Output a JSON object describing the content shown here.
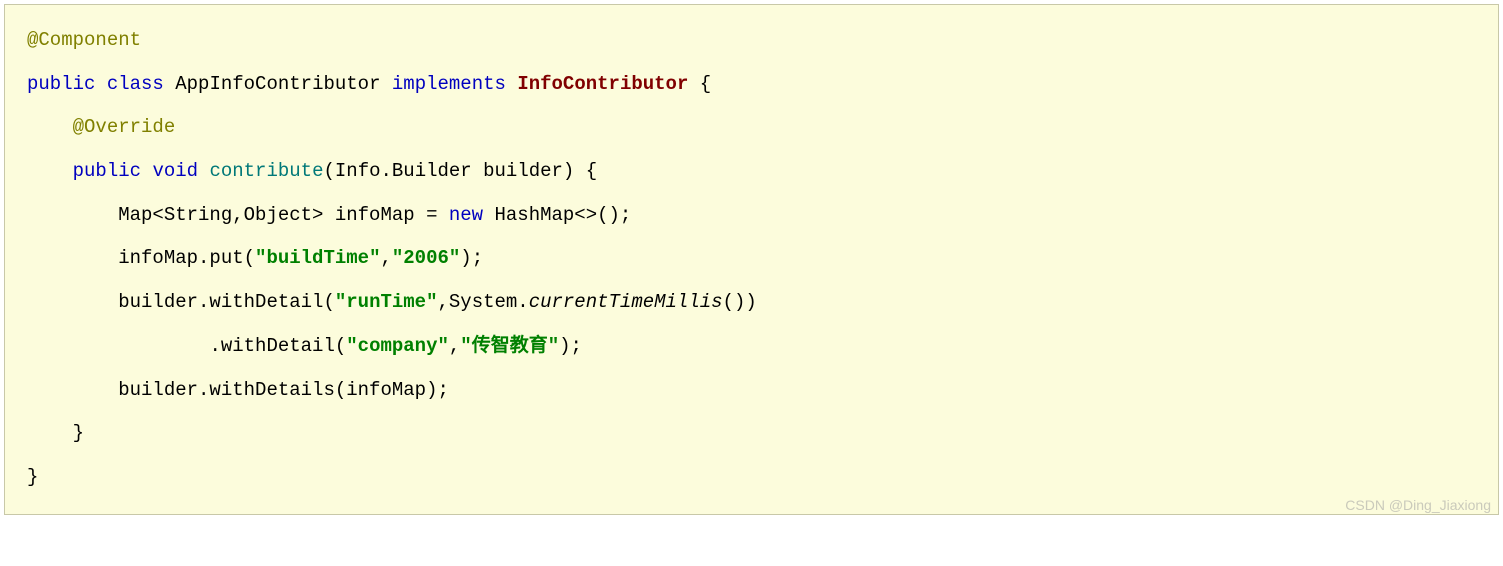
{
  "code": {
    "line1": {
      "annotation": "@Component"
    },
    "line2": {
      "kw_public": "public",
      "kw_class": "class",
      "class_name": " AppInfoContributor ",
      "kw_implements": "implements",
      "interface_name": "InfoContributor",
      "brace": " {"
    },
    "line3": {
      "indent": "    ",
      "annotation": "@Override"
    },
    "line4": {
      "indent": "    ",
      "kw_public": "public",
      "kw_void": "void",
      "method_name": "contribute",
      "params": "(Info.Builder builder) {"
    },
    "line5": {
      "indent": "        ",
      "text1": "Map<String,Object> infoMap = ",
      "kw_new": "new",
      "text2": " HashMap<>();"
    },
    "line6": {
      "indent": "        ",
      "text1": "infoMap.put(",
      "str1": "\"buildTime\"",
      "comma": ",",
      "str2": "\"2006\"",
      "text2": ");"
    },
    "line7": {
      "indent": "        ",
      "text1": "builder.withDetail(",
      "str1": "\"runTime\"",
      "text2": ",System.",
      "italic": "currentTimeMillis",
      "text3": "())"
    },
    "line8": {
      "indent": "                ",
      "text1": ".withDetail(",
      "str1": "\"company\"",
      "comma": ",",
      "str2": "\"传智教育\"",
      "text2": ");"
    },
    "line9": {
      "indent": "        ",
      "text": "builder.withDetails(infoMap);"
    },
    "line10": {
      "indent": "    ",
      "brace": "}"
    },
    "line11": {
      "brace": "}"
    }
  },
  "watermark": "CSDN @Ding_Jiaxiong"
}
